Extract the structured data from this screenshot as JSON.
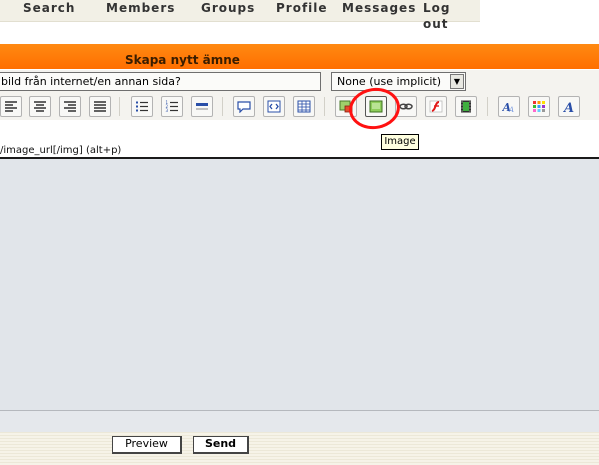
{
  "nav": {
    "items": [
      "Search",
      "Members",
      "Groups",
      "Profile",
      "Messages",
      "Log out"
    ]
  },
  "panel": {
    "title": "Skapa nytt ämne"
  },
  "form": {
    "image_description": "bild från internet/en annan sida?",
    "select_value": "None (use implicit)"
  },
  "toolbar": {
    "buttons": [
      "align-left-icon",
      "align-center-icon",
      "align-right-icon",
      "justify-icon",
      "bulleted-list-icon",
      "numbered-list-icon",
      "horizontal-rule-icon",
      "quote-icon",
      "code-icon",
      "table-icon",
      "image-upload-icon",
      "image-icon",
      "link-icon",
      "flash-icon",
      "video-icon",
      "font-face-icon",
      "color-palette-icon",
      "font-size-icon"
    ],
    "tooltip": "Image"
  },
  "hint": "/image_url[/img] (alt+p)",
  "buttons": {
    "preview": "Preview",
    "send": "Send"
  },
  "colors": {
    "header_orange": "#ff7700",
    "annotation_red": "#ff1111",
    "editor_bg": "#e1e5ea"
  }
}
